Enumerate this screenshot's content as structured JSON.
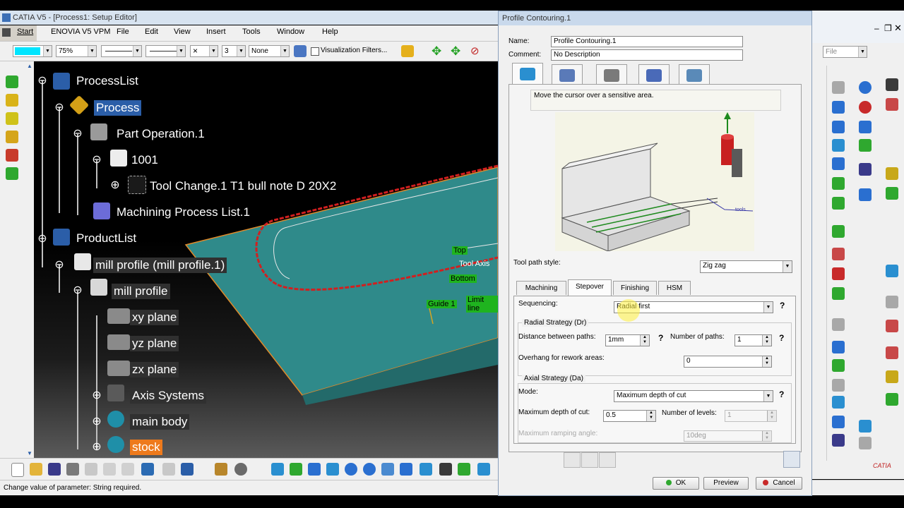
{
  "window": {
    "title": "CATIA V5 - [Process1: Setup Editor]"
  },
  "menu": {
    "items": [
      "Start",
      "ENOVIA V5 VPM",
      "File",
      "Edit",
      "View",
      "Insert",
      "Tools",
      "Window",
      "Help"
    ]
  },
  "toolbar": {
    "zoom": "75%",
    "layer_num": "3",
    "none_label": "None",
    "visualization_filters": "Visualization Filters...",
    "file_combo": "File"
  },
  "tree": {
    "process_list": "ProcessList",
    "process": "Process",
    "part_operation": "Part Operation.1",
    "program": "1001",
    "tool_change": "Tool Change.1  T1 bull note D 20X2",
    "machining_process_list": "Machining Process List.1",
    "product_list": "ProductList",
    "mill_profile_inst": "mill profile (mill profile.1)",
    "mill_profile": "mill profile",
    "xy_plane": "xy plane",
    "yz_plane": "yz plane",
    "zx_plane": "zx plane",
    "axis_systems": "Axis Systems",
    "main_body": "main body",
    "stock": "stock"
  },
  "viewport_labels": {
    "top": "Top",
    "tool_axis": "Tool Axis",
    "bottom": "Bottom",
    "guide": "Guide 1",
    "limit": "Limit line"
  },
  "status": {
    "message": "Change value of parameter: String required."
  },
  "dialog": {
    "title": "Profile Contouring.1",
    "name_label": "Name:",
    "name_value": "Profile Contouring.1",
    "comment_label": "Comment:",
    "comment_value": "No Description",
    "hint": "Move the cursor over a sensitive area.",
    "tool_path_style_label": "Tool path style:",
    "tool_path_style_value": "Zig zag",
    "subtabs": [
      "Machining",
      "Stepover",
      "Finishing",
      "HSM"
    ],
    "sequencing_label": "Sequencing:",
    "sequencing_value": "Radial first",
    "radial_group": "Radial Strategy (Dr)",
    "distance_label": "Distance between paths:",
    "distance_value": "1mm",
    "num_paths_label": "Number of paths:",
    "num_paths_value": "1",
    "overhang_label": "Overhang for rework areas:",
    "overhang_value": "0",
    "axial_group": "Axial Strategy (Da)",
    "mode_label": "Mode:",
    "mode_value": "Maximum depth of cut",
    "max_depth_label": "Maximum depth of cut:",
    "max_depth_value": "0.5",
    "num_levels_label": "Number of levels:",
    "num_levels_value": "1",
    "ramping_label": "Maximum ramping angle:",
    "ramping_value": "10deg",
    "ok": "OK",
    "preview": "Preview",
    "cancel": "Cancel",
    "help_mark": "?",
    "image_label": "tools"
  },
  "colors": {
    "accent": "#2b5ea8",
    "stock_highlight": "#ee7a1c",
    "part": "#2f8a8a",
    "toolpath": "#d21f1f"
  }
}
